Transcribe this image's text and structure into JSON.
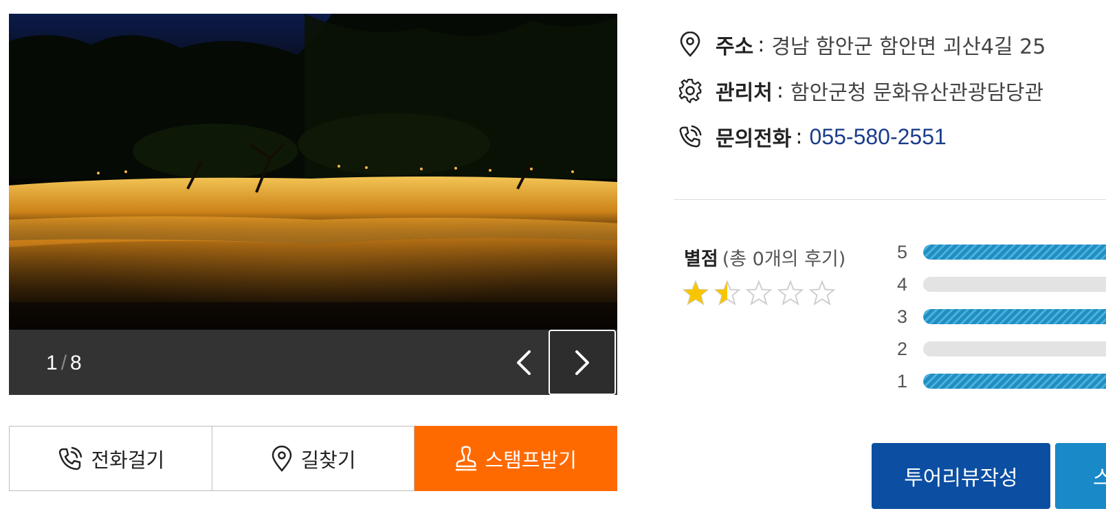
{
  "gallery": {
    "current_page": "1",
    "separator": "/",
    "total_pages": "8"
  },
  "actions": {
    "call_label": "전화걸기",
    "directions_label": "길찾기",
    "stamp_label": "스탬프받기"
  },
  "info": {
    "address_label": "주소",
    "address_value": "경남 함안군 함안면 괴산4길 25",
    "manager_label": "관리처",
    "manager_value": "함안군청 문화유산관광담당관",
    "phone_label": "문의전화",
    "phone_value": "055-580-2551",
    "colon": ":"
  },
  "rating": {
    "title": "별점",
    "review_count_text": "(총 0개의 후기)",
    "score": 1.5,
    "max_score": 5,
    "distribution": [
      {
        "label": "5",
        "fill": 1.0
      },
      {
        "label": "4",
        "fill": 0.0
      },
      {
        "label": "3",
        "fill": 1.0
      },
      {
        "label": "2",
        "fill": 0.0
      },
      {
        "label": "1",
        "fill": 1.0
      }
    ]
  },
  "buttons": {
    "write_review": "투어리뷰작성",
    "second_partial": "스"
  },
  "colors": {
    "stamp_orange": "#ff6a00",
    "review_blue": "#0b4ea2",
    "bar_blue": "#1f8fc2",
    "phone_blue": "#1a3c8a",
    "star_yellow": "#f7c600"
  },
  "icons": {
    "prev": "chevron-left-icon",
    "next": "chevron-right-icon",
    "call": "phone-icon",
    "directions": "map-pin-icon",
    "stamp": "stamp-icon",
    "address": "map-pin-icon",
    "manager": "gear-icon",
    "phone": "phone-icon"
  }
}
